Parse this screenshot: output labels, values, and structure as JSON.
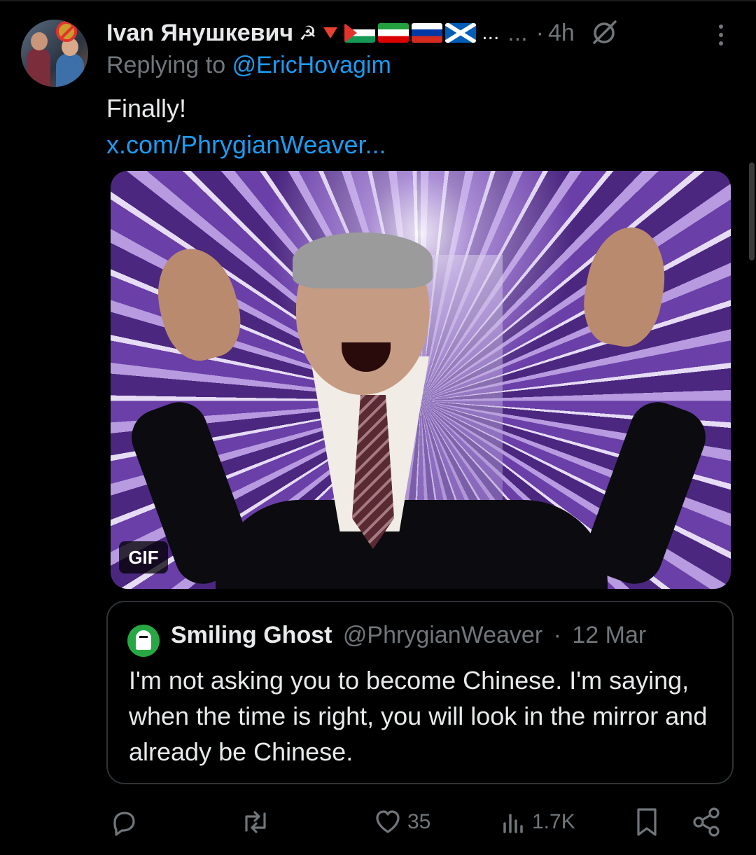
{
  "post": {
    "display_name": "Ivan Янушкевич",
    "name_suffix_truncation": "...",
    "meta_ellipsis": "...",
    "separator": "·",
    "time": "4h",
    "replying_prefix": "Replying to",
    "replying_handle": "@EricHovagim",
    "text": "Finally!",
    "link": "x.com/PhrygianWeaver...",
    "media_badge": "GIF"
  },
  "quoted": {
    "display_name": "Smiling Ghost",
    "handle": "@PhrygianWeaver",
    "separator": "·",
    "date": "12 Mar",
    "text": "I'm not asking you to become Chinese. I'm saying, when the time is right, you will look in the mirror and already be Chinese."
  },
  "actions": {
    "reply_count": "",
    "repost_count": "",
    "like_count": "35",
    "views_count": "1.7K"
  },
  "icons": {
    "reply": "reply-icon",
    "repost": "repost-icon",
    "like": "heart-icon",
    "views": "views-icon",
    "bookmark": "bookmark-icon",
    "share": "share-icon",
    "grok": "grok-icon",
    "more": "more-icon"
  },
  "colors": {
    "background": "#000000",
    "text": "#e7e9ea",
    "muted": "#71767b",
    "link": "#1d9bf0",
    "border": "#2f3336"
  }
}
